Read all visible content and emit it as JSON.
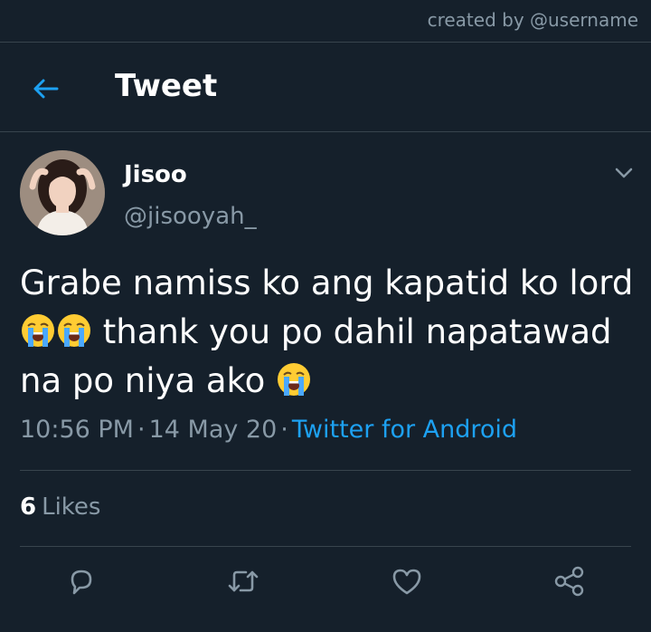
{
  "watermark": "created by @username",
  "header": {
    "title": "Tweet"
  },
  "author": {
    "name": "Jisoo",
    "handle": "@jisooyah_"
  },
  "tweet": {
    "lines": [
      "Grabe namiss ko ang kapatid ko lord",
      " thank you po dahil napatawad",
      "na po niya ako "
    ],
    "emoji_name": "loudly-crying-face"
  },
  "meta": {
    "time": "10:56 PM",
    "separator": "·",
    "date": "14 May 20",
    "source": "Twitter for Android"
  },
  "stats": {
    "likes_count": "6",
    "likes_label": "Likes"
  },
  "colors": {
    "background": "#15202b",
    "divider": "#38444d",
    "muted": "#8899a6",
    "accent": "#1da1f2"
  },
  "icons": [
    "back-arrow-icon",
    "chevron-down-icon",
    "reply-icon",
    "retweet-icon",
    "heart-icon",
    "share-icon"
  ]
}
